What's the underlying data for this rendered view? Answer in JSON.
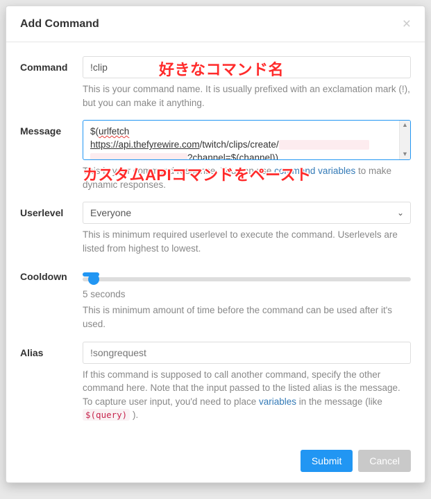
{
  "header": {
    "title": "Add Command"
  },
  "form": {
    "command": {
      "label": "Command",
      "value": "!clip",
      "help": "This is your command name. It is usually prefixed with an exclamation mark (!), but you can make it anything."
    },
    "message": {
      "label": "Message",
      "line1_a": "$(",
      "line1_b": "urlfetch",
      "line2_url": "https://api.thefyrewire.com",
      "line2_plain": "/twitch/clips/create/",
      "line3_plain": "?channel=$(channel))",
      "help_a": "This is your command response. You can use ",
      "help_link": "command variables",
      "help_b": " to make dynamic responses."
    },
    "userlevel": {
      "label": "Userlevel",
      "value": "Everyone",
      "help": "This is minimum required userlevel to execute the command. Userlevels are listed from highest to lowest."
    },
    "cooldown": {
      "label": "Cooldown",
      "seconds": 5,
      "display": "5 seconds",
      "help": "This is minimum amount of time before the command can be used after it's used."
    },
    "alias": {
      "label": "Alias",
      "placeholder": "!songrequest",
      "help_a": "If this command is supposed to call another command, specify the other command here. Note that the input passed to the listed alias is the message. To capture user input, you'd need to place ",
      "help_link": "variables",
      "help_b": " in the message (like ",
      "code": "$(query)",
      "help_c": " )."
    }
  },
  "footer": {
    "submit": "Submit",
    "cancel": "Cancel"
  },
  "annotations": {
    "a1": "好きなコマンド名",
    "a2": "カスタムAPIコマンドをペースト"
  }
}
